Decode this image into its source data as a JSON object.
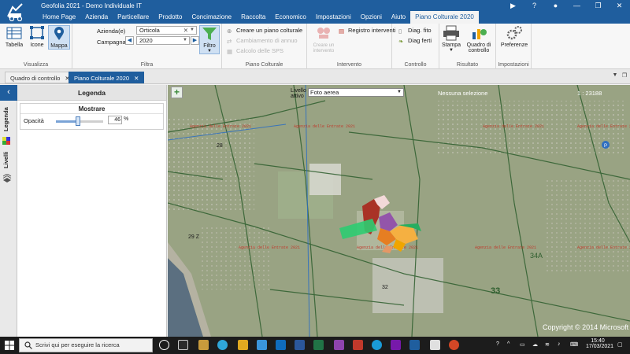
{
  "window": {
    "title": "Geofolia 2021 - Demo Individuale IT",
    "controls": [
      "▶",
      "?",
      "●",
      "—",
      "❐",
      "✕"
    ]
  },
  "menu": {
    "items": [
      "Home Page",
      "Azienda",
      "Particellare",
      "Prodotto",
      "Concimazione",
      "Raccolta",
      "Economico",
      "Impostazioni",
      "Opzioni",
      "Aiuto",
      "Piano Colturale 2020"
    ],
    "active": "Piano Colturale 2020"
  },
  "ribbon": {
    "visualizza": {
      "label": "Visualizza",
      "tabella": "Tabella",
      "icone": "Icone",
      "mappa": "Mappa"
    },
    "filtra": {
      "label": "Filtra",
      "azienda_label": "Azienda(e)",
      "azienda_value": "Orticola",
      "campagna_label": "Campagna",
      "campagna_value": "2020",
      "filtro": "Filtro"
    },
    "piano_colturale": {
      "label": "Piano Colturale",
      "crea": "Creare un piano colturale",
      "cambiamento": "Cambiamento di annuo",
      "calcolo": "Calcolo delle SPS"
    },
    "intervento": {
      "label": "Intervento",
      "creare": "Creare un intervento",
      "registro": "Registro interventi"
    },
    "controllo": {
      "label": "Controllo",
      "diag_fito": "Diag. fito",
      "diag_ferti": "Diag ferti"
    },
    "risultato": {
      "label": "Risultato",
      "stampa": "Stampa",
      "quadro": "Quadro di controllo"
    },
    "impostazioni": {
      "label": "Impostazioni",
      "preferenze": "Preferenze"
    }
  },
  "tabs": [
    {
      "label": "Quadro di controllo",
      "active": false
    },
    {
      "label": "Piano Colturale 2020",
      "active": true
    }
  ],
  "sidebar": {
    "legenda_tab": "Legenda",
    "livelli_tab": "Livelli"
  },
  "legend": {
    "title": "Legenda",
    "show_title": "Mostrare",
    "opacity_label": "Opacità",
    "opacity_value": "46",
    "opacity_unit": "%",
    "opacity_fraction": 0.46
  },
  "map": {
    "layer_label_line1": "Livello",
    "layer_label_line2": "attivo",
    "layer_value": "Foto aerea",
    "selection_text": "Nessuna selezione",
    "scale_text": "1 : 23188",
    "copyright": "Copyright © 2014 Microsoft",
    "field_numbers": [
      "28",
      "29 Z",
      "32",
      "33",
      "34A"
    ]
  },
  "taskbar": {
    "search_placeholder": "Scrivi qui per eseguire la ricerca",
    "time": "15:40",
    "date": "17/03/2021"
  },
  "colors": {
    "brand": "#1f5e9e",
    "map_bg": "#8f9a7a"
  }
}
